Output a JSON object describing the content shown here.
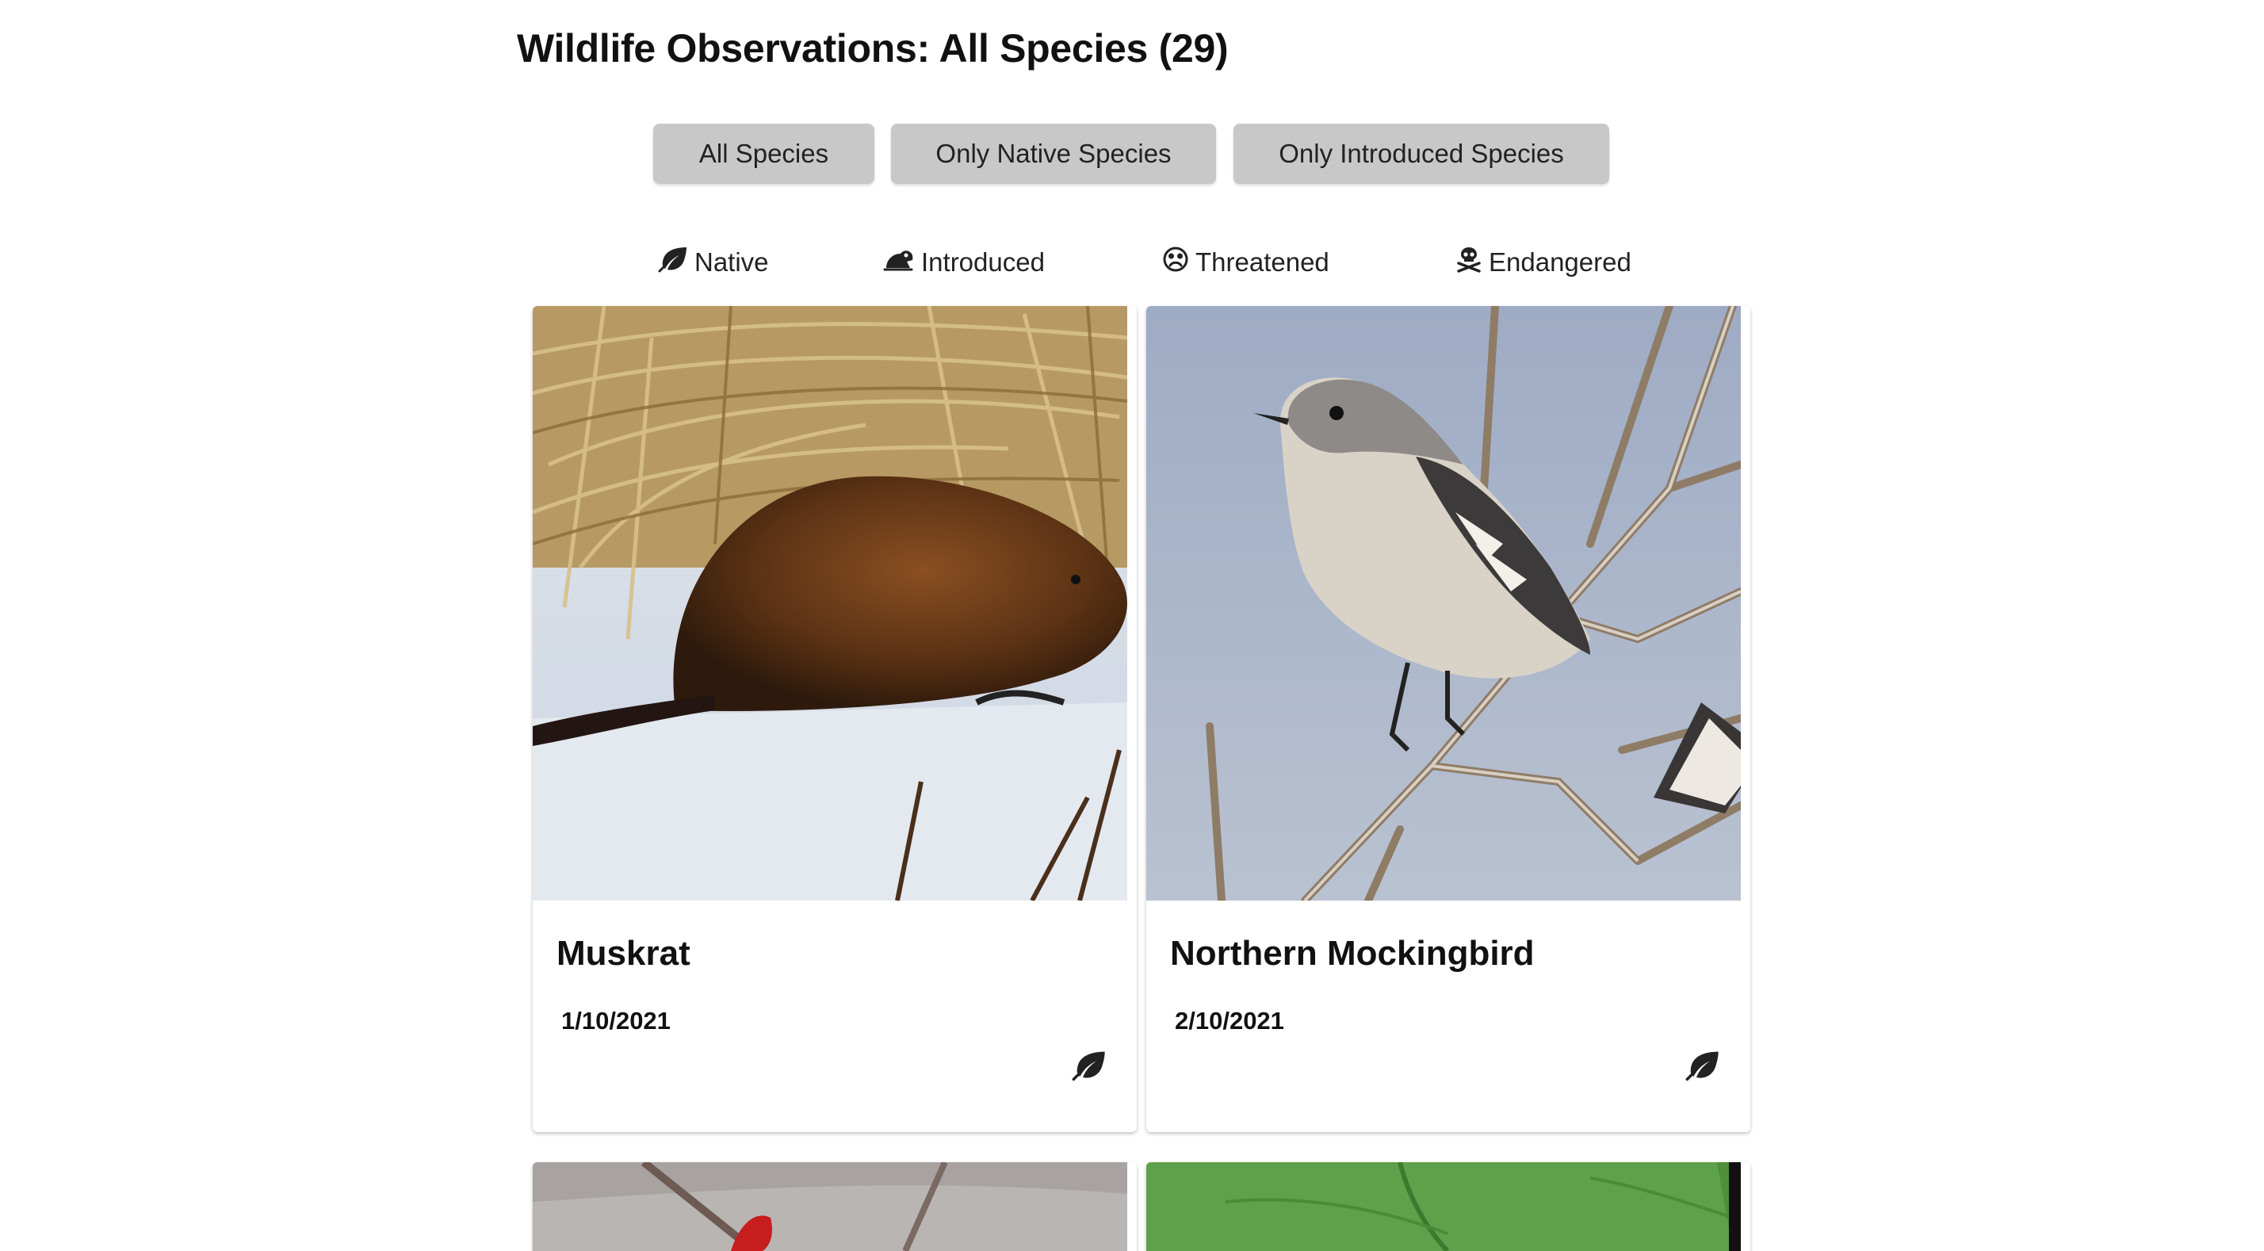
{
  "header": {
    "title": "Wildlife Observations: All Species (29)"
  },
  "filters": [
    {
      "label": "All Species"
    },
    {
      "label": "Only Native Species"
    },
    {
      "label": "Only Introduced Species"
    }
  ],
  "legend": [
    {
      "label": "Native",
      "icon": "leaf-icon"
    },
    {
      "label": "Introduced",
      "icon": "frog-icon"
    },
    {
      "label": "Threatened",
      "icon": "sad-face-icon"
    },
    {
      "label": "Endangered",
      "icon": "skull-crossbones-icon"
    }
  ],
  "observations": [
    {
      "name": "Muskrat",
      "date": "1/10/2021",
      "status": "native",
      "status_icon": "leaf-icon"
    },
    {
      "name": "Northern Mockingbird",
      "date": "2/10/2021",
      "status": "native",
      "status_icon": "leaf-icon"
    }
  ],
  "colors": {
    "button_bg": "#c8c8c8",
    "text": "#111111",
    "page_bg": "#ffffff"
  }
}
